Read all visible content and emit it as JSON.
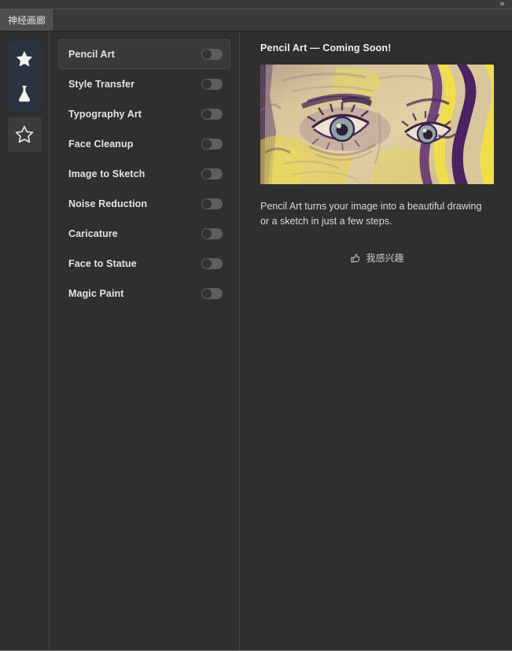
{
  "window": {
    "expand_icon": "double-chevron-right",
    "expand_glyph": "»"
  },
  "tabs": [
    {
      "label": "神经画廊",
      "active": true
    }
  ],
  "rail": {
    "items": [
      {
        "icon": "star-filled-icon",
        "name": "favorites"
      },
      {
        "icon": "flask-icon",
        "name": "experiments"
      },
      {
        "icon": "star-outline-icon",
        "name": "starred"
      }
    ]
  },
  "effects_list": {
    "items": [
      {
        "label": "Pencil Art",
        "enabled": false,
        "selected": true
      },
      {
        "label": "Style Transfer",
        "enabled": false,
        "selected": false
      },
      {
        "label": "Typography Art",
        "enabled": false,
        "selected": false
      },
      {
        "label": "Face Cleanup",
        "enabled": false,
        "selected": false
      },
      {
        "label": "Image to Sketch",
        "enabled": false,
        "selected": false
      },
      {
        "label": "Noise Reduction",
        "enabled": false,
        "selected": false
      },
      {
        "label": "Caricature",
        "enabled": false,
        "selected": false
      },
      {
        "label": "Face to Statue",
        "enabled": false,
        "selected": false
      },
      {
        "label": "Magic Paint",
        "enabled": false,
        "selected": false
      }
    ]
  },
  "detail": {
    "title": "Pencil Art — Coming Soon!",
    "preview_image_alt": "pencil-art-eyes-artwork",
    "description": "Pencil Art turns your image into a beautiful drawing or a sketch in just a few steps.",
    "interest_button": {
      "label": "我感兴趣",
      "icon": "thumbs-up-icon"
    }
  },
  "colors": {
    "app_background": "#2f2f2f",
    "tab_active": "#4f4f4f",
    "rail_group_background": "#2b3341",
    "selected_item_background": "#3a3a3a",
    "toggle_track": "#5e5e5e",
    "toggle_knob": "#333333",
    "text_primary": "#e3e3e3",
    "text_secondary": "#d8d8d8",
    "artwork_yellow": "#e8d44a",
    "artwork_purple": "#4a2060",
    "artwork_cream": "#d8c8a0"
  }
}
